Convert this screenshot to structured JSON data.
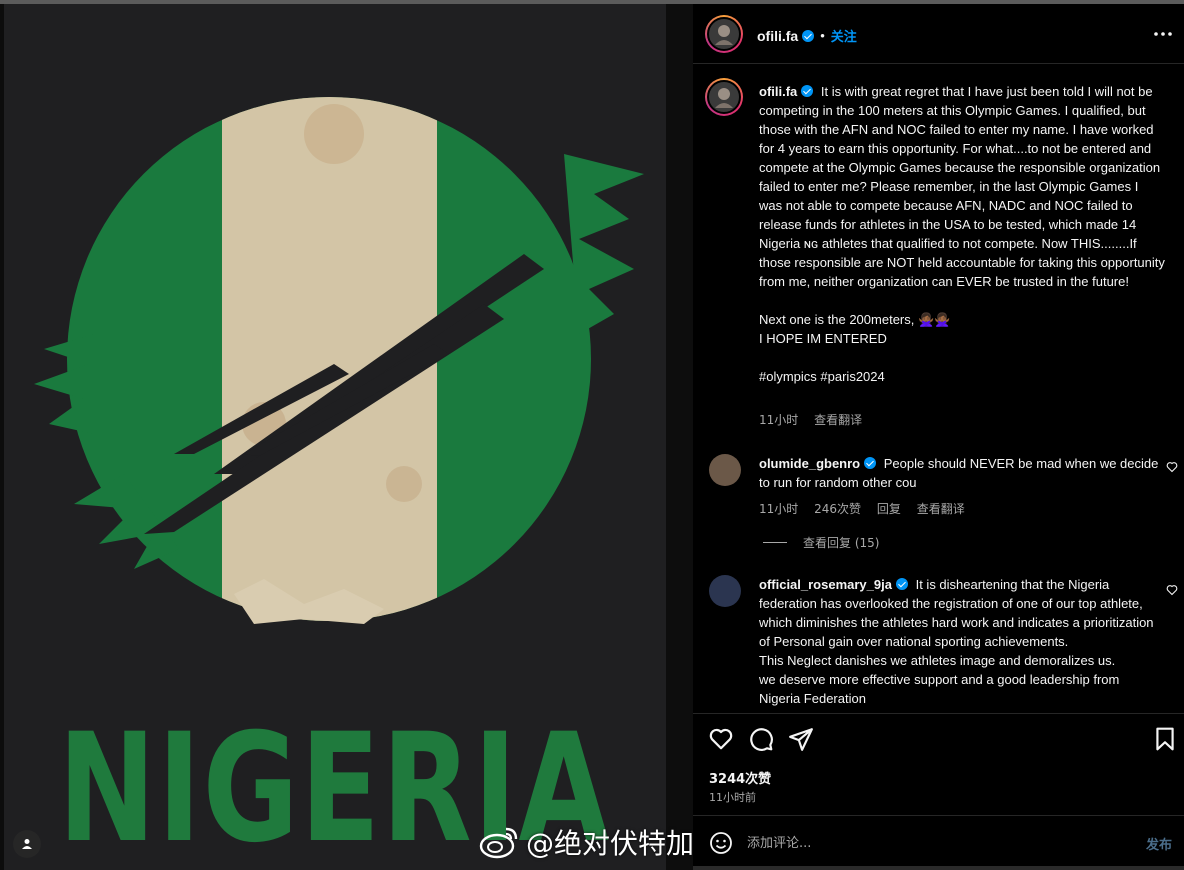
{
  "post": {
    "username": "ofili.fa",
    "follow_label": "关注",
    "image_word": "NIGERIA",
    "caption_username": "ofili.fa",
    "caption_p1": "It is with great regret that I have just been told I will not be competing in the 100 meters at this Olympic Games. I qualified, but those with the AFN and NOC failed to enter my name. I have worked for 4 years to earn this opportunity. For what....to not be entered and compete at the Olympic Games because the responsible organization failed to enter me? Please remember, in the last Olympic Games I was not able to compete because AFN, NADC and NOC failed to release funds for athletes in the USA to be tested, which made 14 Nigeria ɴɢ athletes that qualified to not compete. Now THIS........If those responsible are NOT held accountable for taking this opportunity from me, neither organization can EVER be trusted in the future!",
    "caption_p2": "Next one is the 200meters, 🙅🏾‍♀️🙅🏾‍♀️",
    "caption_p3": "I HOPE IM ENTERED",
    "caption_p4": "#olympics #paris2024",
    "caption_time": "11小时",
    "caption_translate": "查看翻译",
    "likes": "3244次赞",
    "time_ago": "11小时前",
    "comment_placeholder": "添加评论...",
    "post_label": "发布"
  },
  "comments": [
    {
      "username": "olumide_gbenro",
      "text": "People should NEVER be mad when we decide to run for random other cou",
      "time": "11小时",
      "likes": "246次赞",
      "reply": "回复",
      "translate": "查看翻译",
      "view_replies": "查看回复 (15)"
    },
    {
      "username": "official_rosemary_9ja",
      "text": "It is disheartening that the Nigeria federation has overlooked the registration of one of our top athlete, which diminishes the athletes hard work and indicates a prioritization of Personal gain over national sporting achievements.",
      "text2": "This Neglect danishes we athletes image and demoralizes us.",
      "text3": "we deserve more effective support and a good leadership from",
      "text4": "Nigeria Federation"
    }
  ],
  "watermark": {
    "text": "@绝对伏特加"
  },
  "icons": [
    "more-icon",
    "heart-icon",
    "comment-icon",
    "share-icon",
    "bookmark-icon",
    "emoji-icon",
    "tag-user-icon",
    "verified-badge-icon"
  ]
}
